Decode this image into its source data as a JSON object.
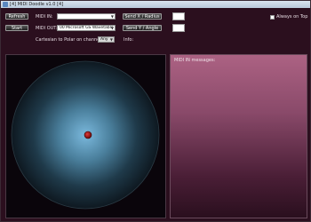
{
  "window": {
    "title": "[4] MIDI Doodle v1.0 [4]"
  },
  "toolbar": {
    "refresh_label": "Refresh",
    "start_label": "Start",
    "send_x_radius_label": "Send X / Radius",
    "send_y_angle_label": "Send Y / Angle",
    "always_on_top_label": "Always on Top"
  },
  "midi": {
    "in_label": "MIDI IN:",
    "in_value": "",
    "out_label": "MIDI OUT:",
    "out_value": "00 Microsoft GS Wavetable"
  },
  "options": {
    "cartesian_label": "Cartesian to Polar on channel:",
    "channel_value": "Any",
    "info_label": "Info:"
  },
  "messages": {
    "label": "MIDI IN messages:"
  },
  "colors": {
    "background": "#2b0f1e",
    "messages_top": "#ac6283",
    "pad_center": "#7ab8dc",
    "cursor": "#b01818"
  }
}
